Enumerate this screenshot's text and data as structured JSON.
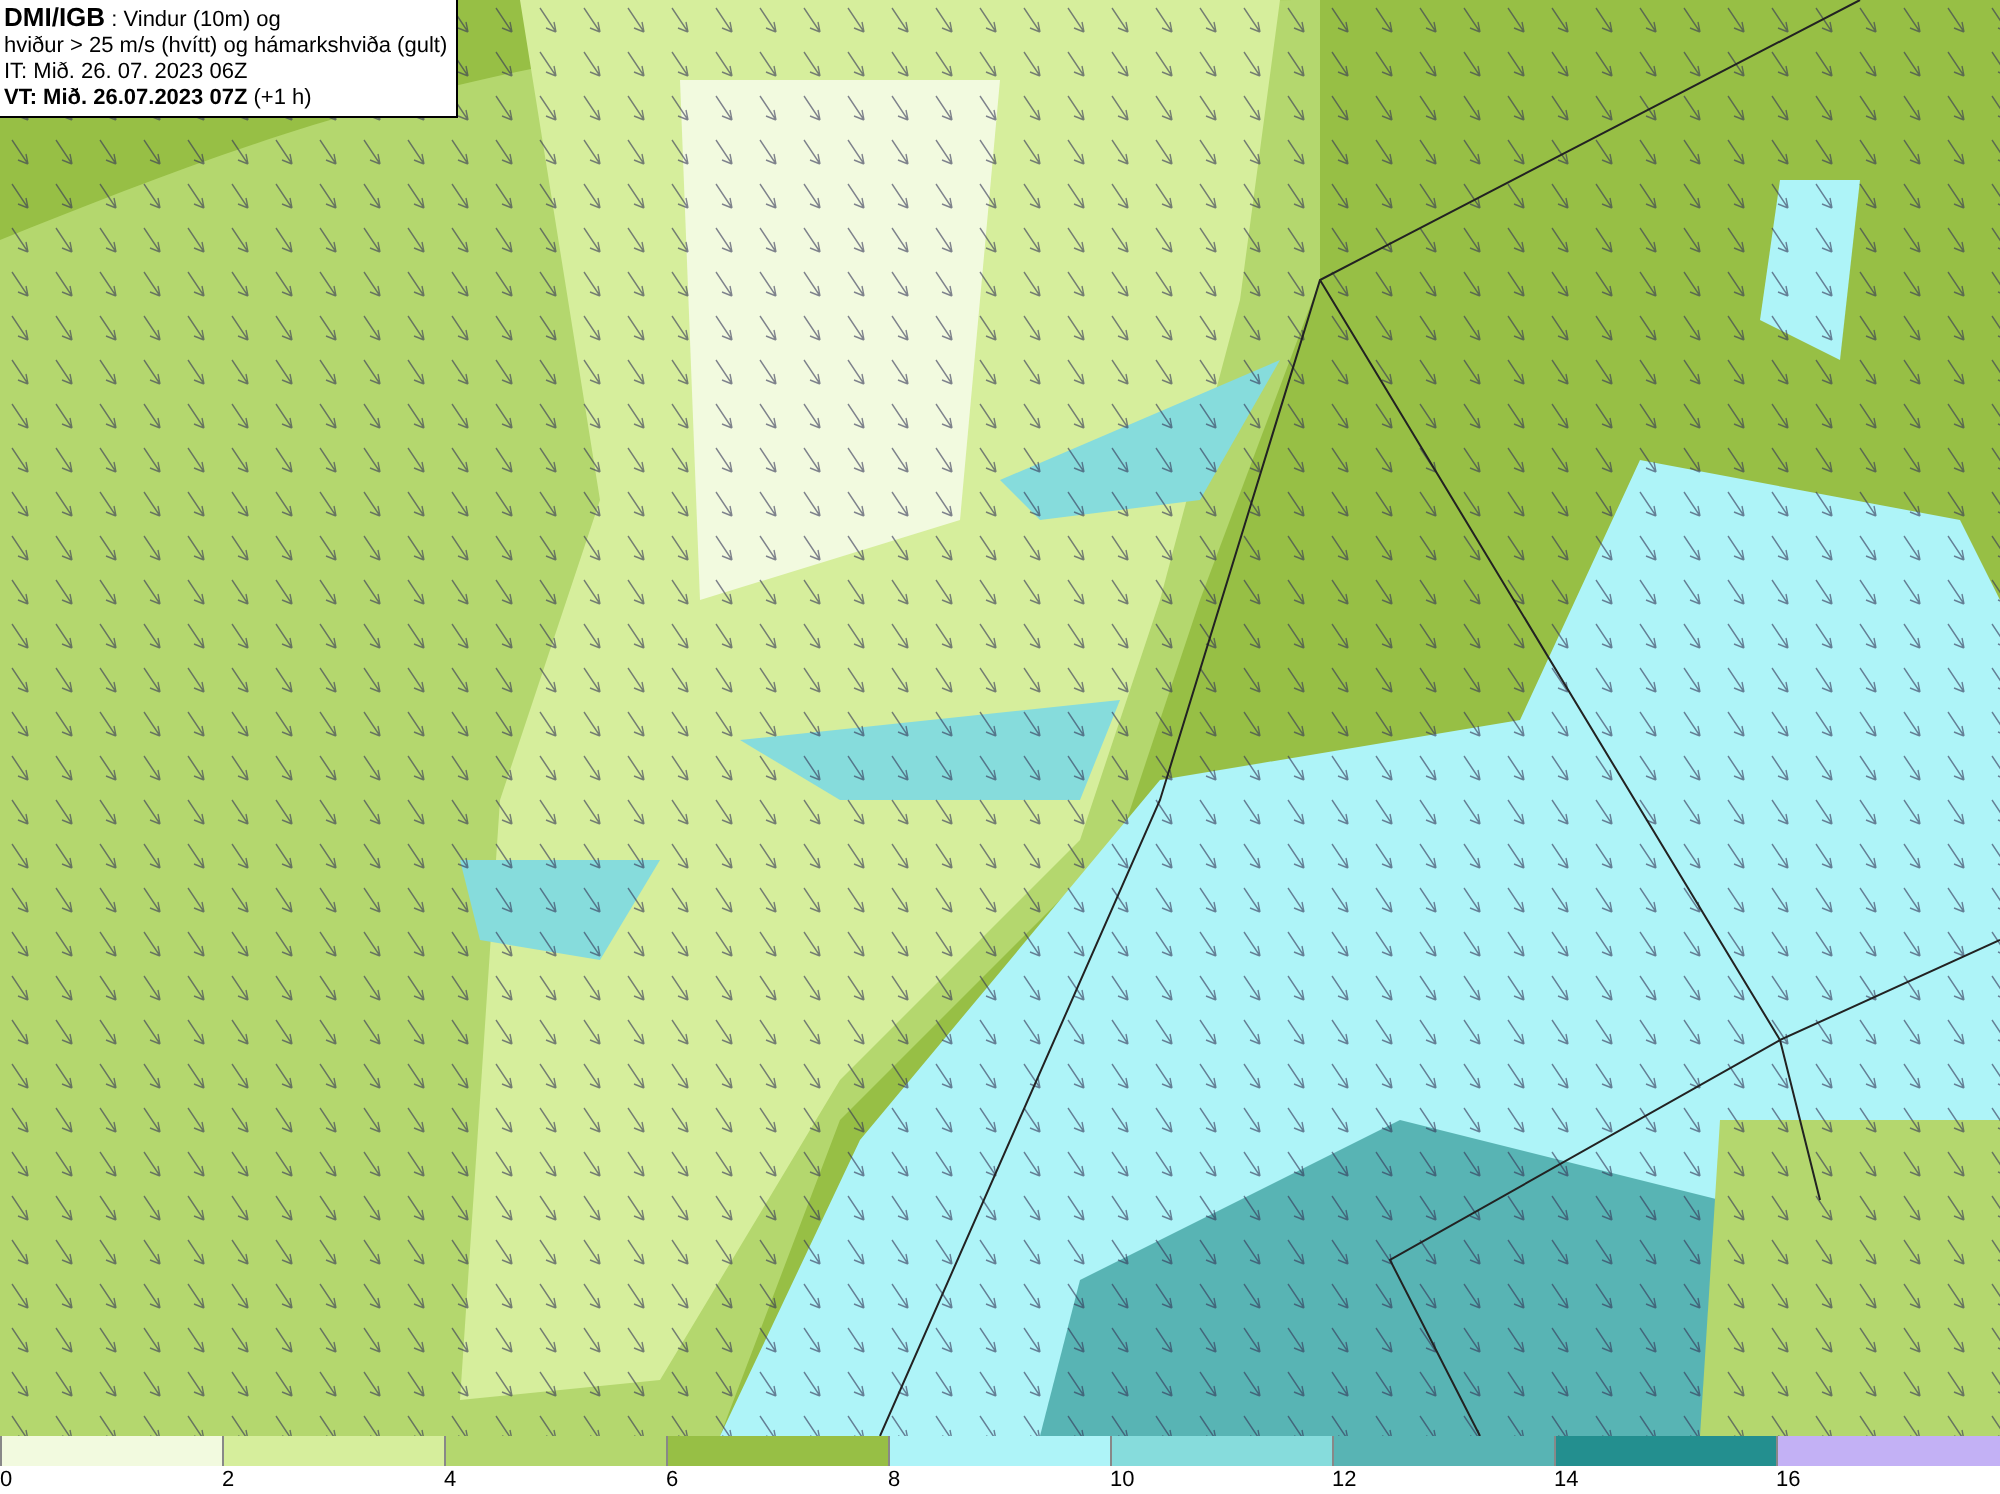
{
  "title_box": {
    "lines": [
      "**DMI/IGB** : Vindur (10m) og",
      "hviður > 25 m/s (hvítt) og hámarkshviða (gult)",
      "IT: Mið. 26. 07. 2023 06Z",
      "**VT: Mið. 26.07.2023 07Z** (+1 h)"
    ]
  },
  "legend": {
    "segments": [
      {
        "color": "#f2fadf",
        "label": "0"
      },
      {
        "color": "#d6ee9c",
        "label": "2"
      },
      {
        "color": "#b4d76e",
        "label": "4"
      },
      {
        "color": "#97bf45",
        "label": "6"
      },
      {
        "color": "#aef4f8",
        "label": "8"
      },
      {
        "color": "#86dcdc",
        "label": "10"
      },
      {
        "color": "#58b4b4",
        "label": "12"
      },
      {
        "color": "#238f8f",
        "label": "14"
      },
      {
        "color": "#c3b1f5",
        "label": "16"
      }
    ]
  }
}
